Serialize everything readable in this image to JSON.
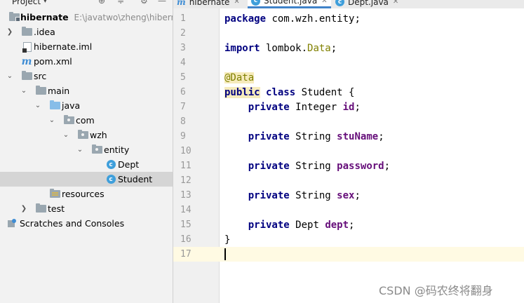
{
  "project_panel": {
    "title": "Project",
    "dropdown_arrow": "▾",
    "header_icons": [
      "add-icon",
      "collapse-icon",
      "gear-icon",
      "minimize-icon"
    ]
  },
  "tree": {
    "root": {
      "name": "hibernate",
      "path": "E:\\javatwo\\zheng\\hibernat"
    },
    "idea": ".idea",
    "iml": "hibernate.iml",
    "pom": "pom.xml",
    "src": "src",
    "main": "main",
    "java": "java",
    "com": "com",
    "wzh": "wzh",
    "entity": "entity",
    "dept": "Dept",
    "student": "Student",
    "resources": "resources",
    "test": "test",
    "scratches": "Scratches and Consoles"
  },
  "tabs": [
    {
      "label": "hibernate",
      "icon": "maven-icon",
      "active": false
    },
    {
      "label": "Student.java",
      "icon": "class-icon",
      "active": true
    },
    {
      "label": "Dept.java",
      "icon": "class-icon",
      "active": false
    }
  ],
  "editor": {
    "line_numbers": [
      "1",
      "2",
      "3",
      "4",
      "5",
      "6",
      "7",
      "8",
      "9",
      "10",
      "11",
      "12",
      "13",
      "14",
      "15",
      "16",
      "17"
    ],
    "current_line": 17,
    "code": {
      "l1": {
        "kw": "package",
        "rest": " com.wzh.entity;"
      },
      "l3": {
        "kw": "import",
        "pkg": " lombok.",
        "ref": "Data",
        "end": ";"
      },
      "l5": {
        "ann": "@Data"
      },
      "l6": {
        "kw1": "public",
        "kw2": "class",
        "rest": " Student {"
      },
      "l7": {
        "kw": "private",
        "type": " Integer ",
        "field": "id",
        "end": ";"
      },
      "l9": {
        "kw": "private",
        "type": " String ",
        "field": "stuName",
        "end": ";"
      },
      "l11": {
        "kw": "private",
        "type": " String ",
        "field": "password",
        "end": ";"
      },
      "l13": {
        "kw": "private",
        "type": " String ",
        "field": "sex",
        "end": ";"
      },
      "l15": {
        "kw": "private",
        "type": " Dept ",
        "field": "dept",
        "end": ";"
      },
      "l16": {
        "rest": "}"
      }
    }
  },
  "watermark": "CSDN @码农终将翻身",
  "colors": {
    "keyword": "#000080",
    "field": "#660e7a",
    "annotation": "#808000",
    "current_line": "#fffae3",
    "selection": "#d5d5d5",
    "tab_underline": "#4083c9"
  }
}
